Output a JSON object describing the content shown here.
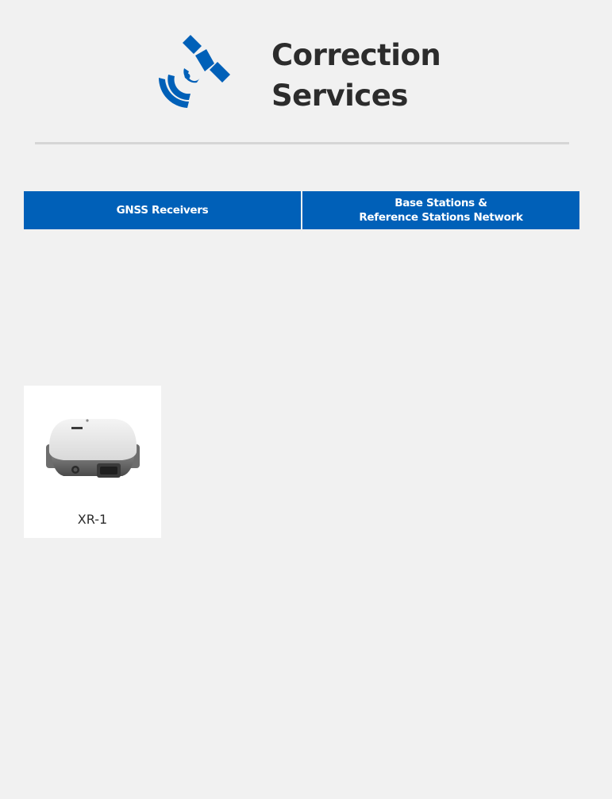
{
  "header": {
    "title": "Correction\nServices",
    "icon": "satellite-signal-icon",
    "accent_color": "#0060b8"
  },
  "tabs": [
    {
      "label": "GNSS Receivers"
    },
    {
      "label": "Base Stations &\nReference Stations Network"
    }
  ],
  "products": [
    {
      "name": "XR-1",
      "image": "gnss-receiver-device-image"
    }
  ]
}
